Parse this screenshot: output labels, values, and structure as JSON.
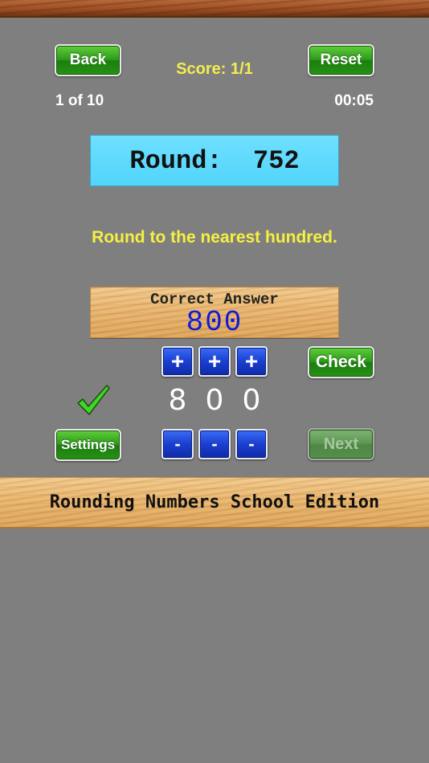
{
  "header": {
    "back_label": "Back",
    "reset_label": "Reset",
    "score": "Score: 1/1",
    "progress": "1 of 10",
    "timer": "00:05"
  },
  "question": {
    "prompt": "Round:  752",
    "instruction": "Round to the nearest hundred."
  },
  "answer": {
    "title": "Correct Answer",
    "value": "800",
    "digits": [
      "8",
      "0",
      "0"
    ],
    "result": "correct"
  },
  "controls": {
    "plus_label": "+",
    "minus_label": "-",
    "check_label": "Check",
    "settings_label": "Settings",
    "next_label": "Next",
    "next_enabled": false
  },
  "footer": {
    "app_title": "Rounding Numbers School Edition"
  },
  "colors": {
    "background": "#7f7f7f",
    "score_text": "#f3ed4f",
    "instruction_text": "#f7f03f",
    "round_box": "#52d4fb",
    "answer_value": "#1419d8",
    "check_mark": "#3fd62a"
  }
}
